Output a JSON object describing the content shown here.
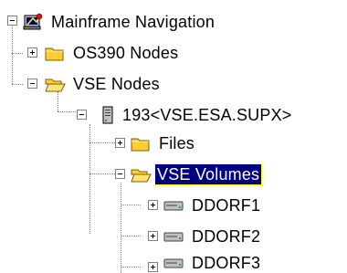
{
  "tree": {
    "root": {
      "label": "Mainframe Navigation",
      "icon": "mainframe-navigation-icon",
      "expanded": true
    },
    "os390": {
      "label": "OS390 Nodes",
      "icon": "folder-closed-icon",
      "expanded": false
    },
    "vse": {
      "label": "VSE Nodes",
      "icon": "folder-open-icon",
      "expanded": true
    },
    "host": {
      "label": "193<VSE.ESA.SUPX>",
      "icon": "server-icon",
      "expanded": true
    },
    "files": {
      "label": "Files",
      "icon": "folder-closed-icon",
      "expanded": false
    },
    "volumes": {
      "label": "VSE Volumes",
      "icon": "folder-open-icon",
      "expanded": true,
      "selected": true
    },
    "disks": [
      {
        "label": "DDORF1",
        "icon": "disk-drive-icon",
        "expanded": false
      },
      {
        "label": "DDORF2",
        "icon": "disk-drive-icon",
        "expanded": false
      },
      {
        "label": "DDORF3",
        "icon": "disk-drive-icon",
        "expanded": false
      }
    ]
  },
  "colors": {
    "selection_bg": "#000080",
    "selection_text": "#ffffff",
    "folder": "#ffcc33"
  }
}
